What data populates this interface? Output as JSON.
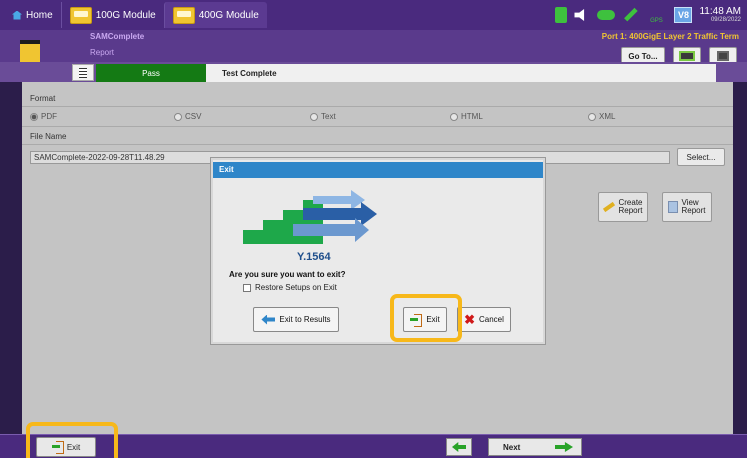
{
  "topbar": {
    "home_label": "Home",
    "tabs": [
      {
        "label": "100G Module"
      },
      {
        "label": "400G Module"
      }
    ],
    "gps_label": "GPS",
    "v8_label": "V8",
    "time": "11:48 AM",
    "date": "09/28/2022"
  },
  "header": {
    "app_title": "SAMComplete",
    "section": "Report",
    "port_info": "Port 1: 400GigE Layer 2 Traffic Term",
    "goto_label": "Go To..."
  },
  "strip": {
    "pass_label": "Pass",
    "status_label": "Test Complete"
  },
  "form": {
    "format_label": "Format",
    "format_options": [
      {
        "label": "PDF",
        "selected": true
      },
      {
        "label": "CSV",
        "selected": false
      },
      {
        "label": "Text",
        "selected": false
      },
      {
        "label": "HTML",
        "selected": false
      },
      {
        "label": "XML",
        "selected": false
      }
    ],
    "file_name_label": "File Name",
    "file_name_value": "SAMComplete-2022-09-28T11.48.29",
    "select_label": "Select...",
    "create_report_label": "Create\nReport",
    "view_report_label": "View\nReport"
  },
  "dialog": {
    "title": "Exit",
    "logo_text": "Y.1564",
    "message": "Are you sure you want to exit?",
    "checkbox_label": "Restore Setups on Exit",
    "checkbox_checked": false,
    "exit_to_results_label": "Exit to Results",
    "exit_label": "Exit",
    "cancel_label": "Cancel"
  },
  "bottombar": {
    "exit_label": "Exit",
    "next_label": "Next"
  },
  "colors": {
    "accent_purple": "#4a2a7e",
    "pass_green": "#147a14",
    "dialog_title_blue": "#2f86c9",
    "highlight_yellow": "#f7b81a"
  }
}
